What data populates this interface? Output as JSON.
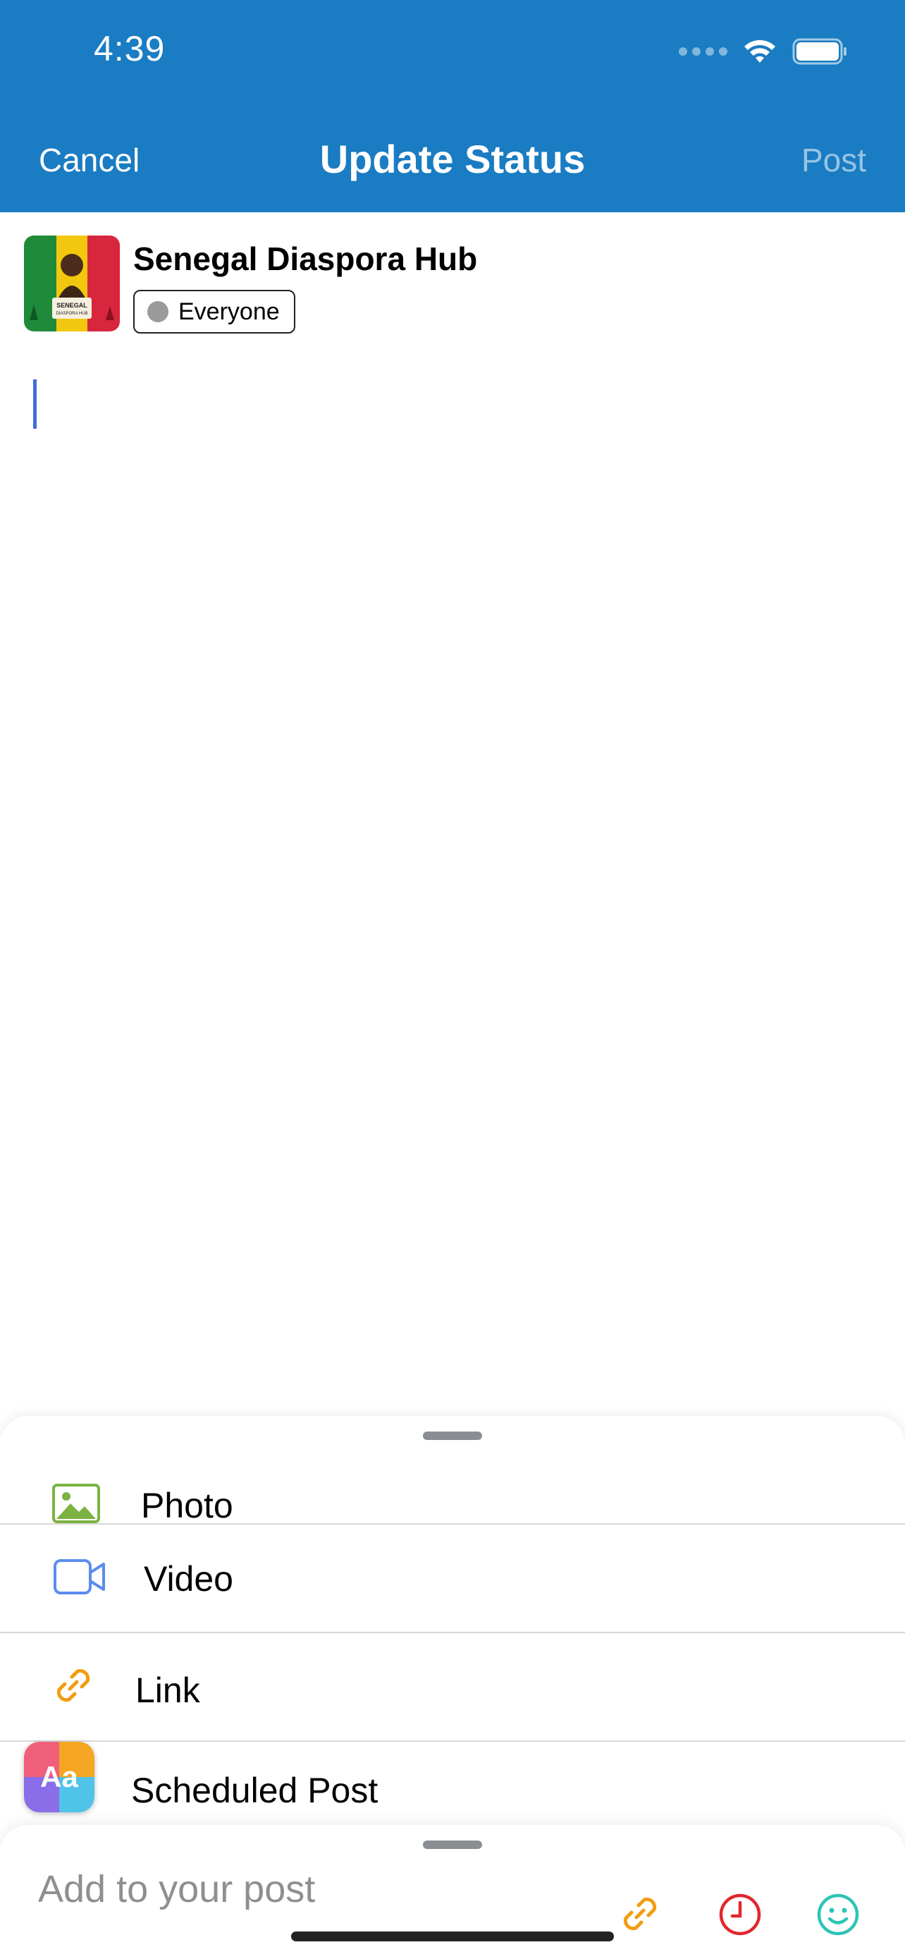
{
  "status_bar": {
    "time": "4:39"
  },
  "nav": {
    "cancel": "Cancel",
    "title": "Update Status",
    "post": "Post"
  },
  "author": {
    "name": "Senegal Diaspora Hub",
    "audience": "Everyone",
    "avatar_text": "SENEGAL DIASPORA HUB"
  },
  "options": [
    {
      "label": "Photo",
      "icon": "photo-icon",
      "color": "#7cb342"
    },
    {
      "label": "Video",
      "icon": "video-icon",
      "color": "#5b8def"
    },
    {
      "label": "Link",
      "icon": "link-icon",
      "color": "#f39c12"
    },
    {
      "label": "Scheduled Post",
      "icon": "scheduled-icon",
      "color": "#e0282e"
    }
  ],
  "bottom_bar": {
    "placeholder": "Add to your post",
    "icons": [
      "link-icon",
      "clock-icon",
      "smiley-icon"
    ],
    "colors": {
      "link": "#f39c12",
      "clock": "#e0282e",
      "smiley": "#2ec4b6"
    }
  },
  "colors": {
    "header": "#1a7cc2",
    "caret": "#3f6ddc"
  }
}
